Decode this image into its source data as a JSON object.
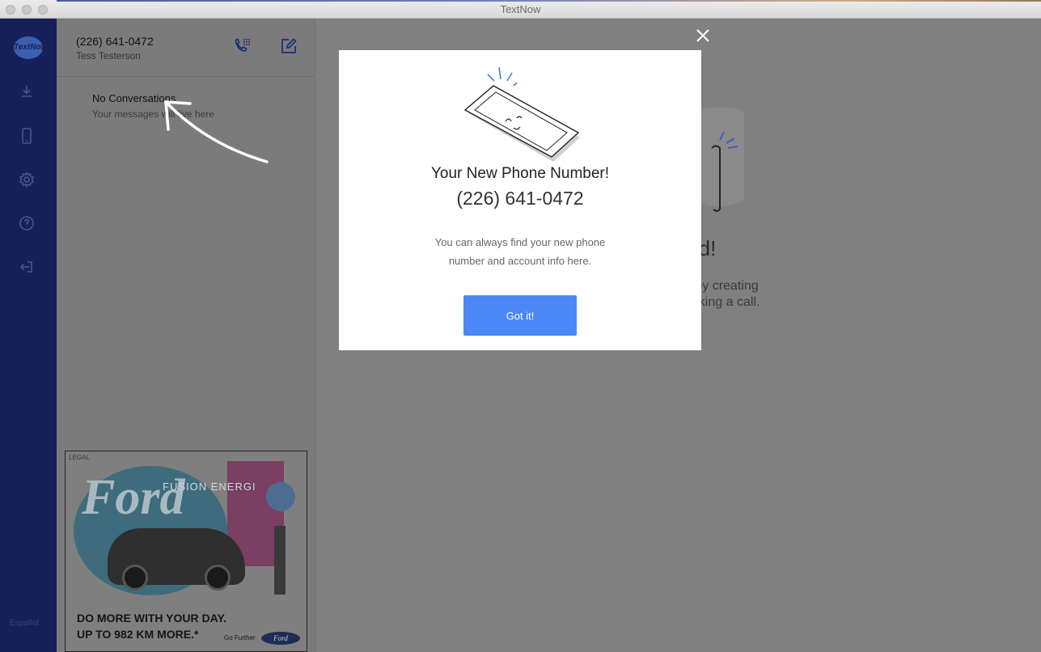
{
  "window": {
    "title": "TextNow"
  },
  "nav": {
    "logo_text": "TextNow",
    "language_label": "Español",
    "icons": [
      "download-icon",
      "phone-device-icon",
      "gear-icon",
      "help-icon",
      "logout-icon"
    ]
  },
  "account": {
    "phone": "(226) 641-0472",
    "name": "Tess Testerson"
  },
  "conversations": {
    "empty_title": "No Conversations",
    "empty_subtitle": "Your messages will live here"
  },
  "ad": {
    "legal": "LEGAL",
    "brand": "Ford",
    "model": "FUSION ENERGI",
    "tagline_1": "DO MORE WITH YOUR DAY.",
    "tagline_2": "UP TO 982 KM MORE.*",
    "slogan": "Go Further",
    "logo": "Ford"
  },
  "main": {
    "heading_fragment": "ted!",
    "line_1": "n by creating",
    "line_2": "naking a call."
  },
  "modal": {
    "title": "Your New Phone Number!",
    "number": "(226) 641-0472",
    "message": "You can always find your new phone number and account info here.",
    "button": "Got it!"
  },
  "colors": {
    "nav": "#18205a",
    "accent": "#4a88f7",
    "overlay": "#808080"
  }
}
